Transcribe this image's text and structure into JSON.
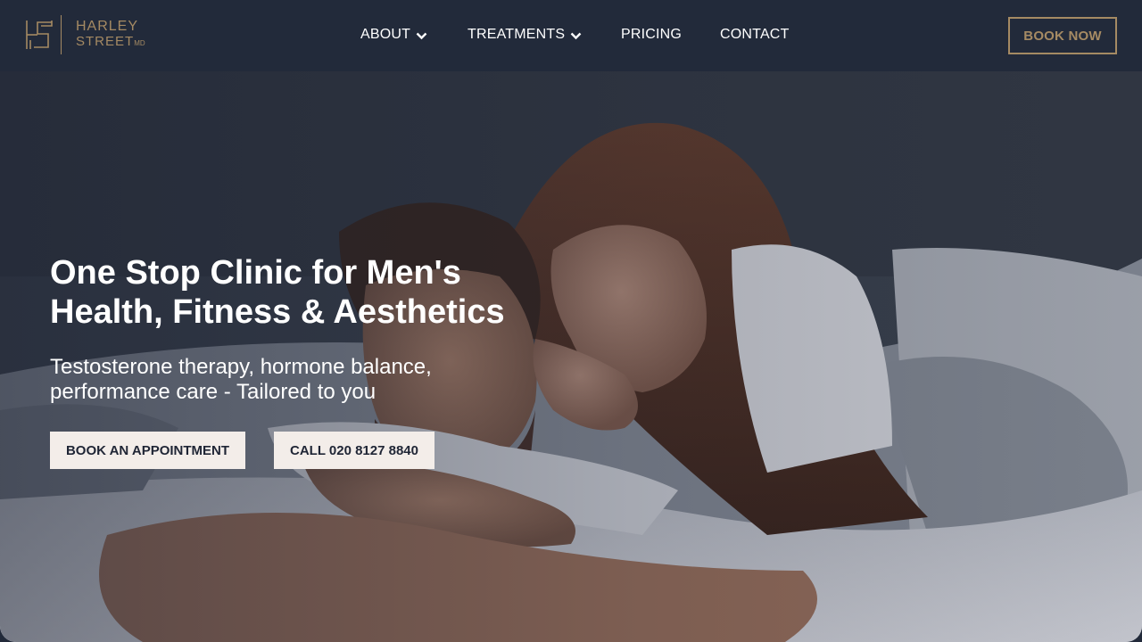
{
  "brand": {
    "line1": "HARLEY",
    "line2": "STREET",
    "suffix": "MD",
    "logo_icon": "hs-monogram-icon",
    "accent_color": "#a58a63",
    "nav_bg_color": "#222a3a"
  },
  "nav": {
    "items": [
      {
        "label": "ABOUT",
        "has_dropdown": true
      },
      {
        "label": "TREATMENTS",
        "has_dropdown": true
      },
      {
        "label": "PRICING",
        "has_dropdown": false
      },
      {
        "label": "CONTACT",
        "has_dropdown": false
      }
    ],
    "cta_label": "BOOK NOW"
  },
  "hero": {
    "title_line1": "One Stop Clinic for Men's",
    "title_line2": "Health, Fitness & Aesthetics",
    "subtitle_line1": "Testosterone therapy, hormone balance,",
    "subtitle_line2": "performance care - Tailored to you",
    "primary_button": "BOOK AN APPOINTMENT",
    "secondary_button": "CALL 020 8127 8840",
    "button_bg_color": "#f3ede9"
  }
}
